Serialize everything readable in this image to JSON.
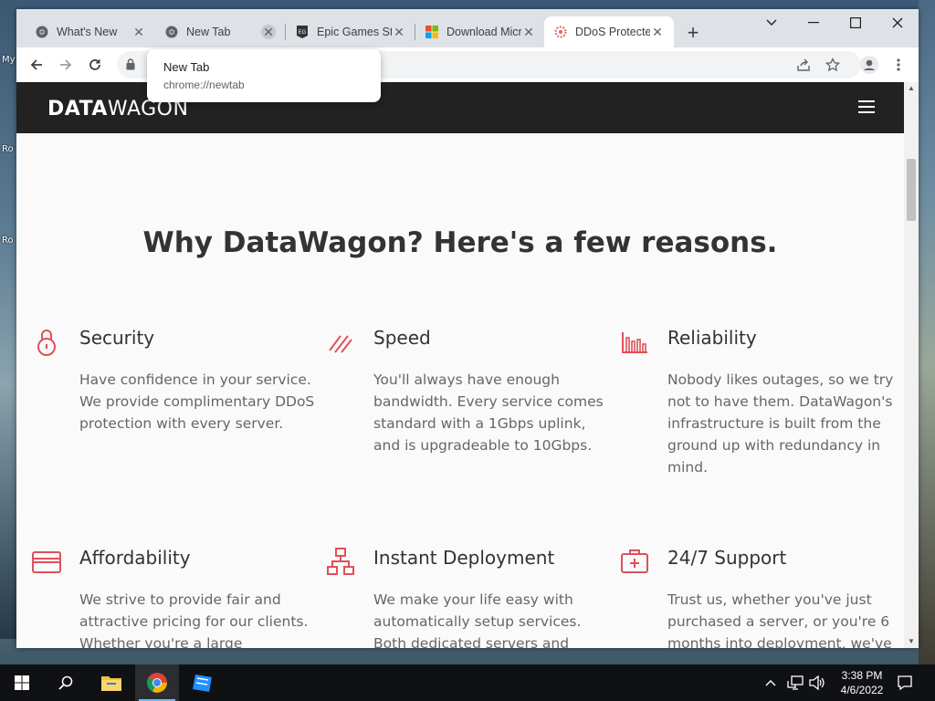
{
  "desktop": {
    "icon_labels": [
      "My",
      "Ro",
      "Ro"
    ]
  },
  "tabs": [
    {
      "title": "What's New",
      "icon": "chrome-icon"
    },
    {
      "title": "New Tab",
      "icon": "chrome-icon"
    },
    {
      "title": "Epic Games Store",
      "icon": "epic-games-icon"
    },
    {
      "title": "Download Microsoft",
      "icon": "microsoft-icon"
    },
    {
      "title": "DDoS Protected",
      "icon": "datawagon-icon"
    }
  ],
  "tooltip": {
    "title": "New Tab",
    "url": "chrome://newtab"
  },
  "site": {
    "logo_bold": "DATA",
    "logo_light": "WAGON",
    "headline": "Why DataWagon? Here's a few reasons.",
    "features": [
      {
        "title": "Security",
        "icon": "lock-icon",
        "text": "Have confidence in your service. We provide complimentary DDoS protection with every server."
      },
      {
        "title": "Speed",
        "icon": "speed-lines-icon",
        "text": "You'll always have enough bandwidth. Every service comes standard with a 1Gbps uplink, and is upgradeable to 10Gbps."
      },
      {
        "title": "Reliability",
        "icon": "bar-chart-icon",
        "text": "Nobody likes outages, so we try not to have them. DataWagon's infrastructure is built from the ground up with redundancy in mind."
      },
      {
        "title": "Affordability",
        "icon": "credit-card-icon",
        "text": "We strive to provide fair and attractive pricing for our clients. Whether you're a large"
      },
      {
        "title": "Instant Deployment",
        "icon": "network-icon",
        "text": "We make your life easy with automatically setup services. Both dedicated servers and"
      },
      {
        "title": "24/7 Support",
        "icon": "first-aid-icon",
        "text": "Trust us, whether you've just purchased a server, or you're 6 months into deployment, we've"
      }
    ]
  },
  "taskbar": {
    "time": "3:38 PM",
    "date": "4/6/2022"
  },
  "colors": {
    "accent": "#e0505a",
    "sitebar": "#222222",
    "tabstrip": "#dee1e6"
  }
}
